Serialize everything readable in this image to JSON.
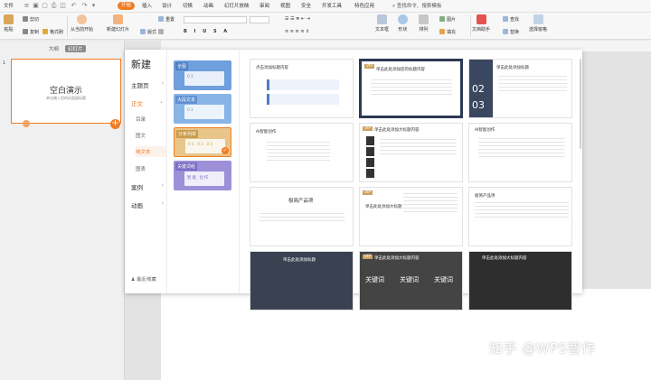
{
  "menubar": {
    "file": "文件",
    "tabs": [
      "开始",
      "插入",
      "设计",
      "切换",
      "动画",
      "幻灯片放映",
      "审阅",
      "视图",
      "安全",
      "开发工具",
      "特色应用"
    ],
    "active_tab": "开始",
    "search": "查找命令、搜索模板"
  },
  "ribbon": {
    "paste": "粘贴",
    "cut": "剪切",
    "copy": "复制",
    "format_painter": "格式刷",
    "from_current": "从当前开始",
    "new_slide": "新建幻灯片",
    "layout": "版式",
    "reset": "重置",
    "textbox": "文本框",
    "shape": "形状",
    "arrange": "排列",
    "picture": "图片",
    "fill": "填充",
    "find": "查找",
    "replace": "替换",
    "text_assist": "文档助手",
    "select_pane": "选择窗格"
  },
  "left_panel": {
    "tabs": [
      "大纲",
      "幻灯片"
    ],
    "selected_tab": "幻灯片",
    "slide_number": "1",
    "slide_title": "空白演示",
    "slide_subtitle": "单击输入您的封面副标题"
  },
  "new_panel": {
    "title": "新建",
    "categories": [
      {
        "label": "主题页",
        "arrow": "›"
      },
      {
        "label": "正文",
        "arrow": "⌄"
      },
      {
        "label": "案例",
        "arrow": "›"
      },
      {
        "label": "动画",
        "arrow": "›"
      }
    ],
    "selected_category": "正文",
    "subcategories": [
      "目录",
      "图文",
      "纯文本",
      "图表"
    ],
    "selected_sub": "纯文本",
    "footer": "最近/收藏",
    "styles": [
      {
        "label": "全图",
        "inner": "01"
      },
      {
        "label": "大段文本",
        "inner": "01"
      },
      {
        "label": "分条列举",
        "inner": "01  02  03"
      },
      {
        "label": "关键词组",
        "inner": "智能   创作"
      }
    ],
    "styles_colors": [
      "#6f9fdc",
      "#89b4e6",
      "#e8c68a",
      "#9d8fd8"
    ],
    "templates": [
      {
        "title": "点击添加标题内容",
        "vip": ""
      },
      {
        "title": "单击此处添加您的标题内容",
        "vip": "VIP"
      },
      {
        "title": "单击此处添加标题",
        "vip": ""
      },
      {
        "title": "AI智能创作",
        "vip": ""
      },
      {
        "title": "单击此处添加大标题内容",
        "vip": "VIP"
      },
      {
        "title": "AI智能创作",
        "vip": ""
      },
      {
        "title": "极简产品项",
        "vip": ""
      },
      {
        "title": "单击此处添加大标题",
        "vip": "VIP"
      },
      {
        "title": "极简产品项",
        "vip": ""
      },
      {
        "title": "单击此处添加标题",
        "vip": ""
      },
      {
        "title": "单击此处添加大标题内容",
        "vip": "VIP"
      },
      {
        "title": "单击此处添加大标题内容",
        "vip": ""
      }
    ],
    "number_tiles": [
      "02",
      "03"
    ],
    "keyword_tiles": [
      "关键词",
      "关键词",
      "关键词"
    ]
  },
  "watermark": "知乎 @WPS智作"
}
